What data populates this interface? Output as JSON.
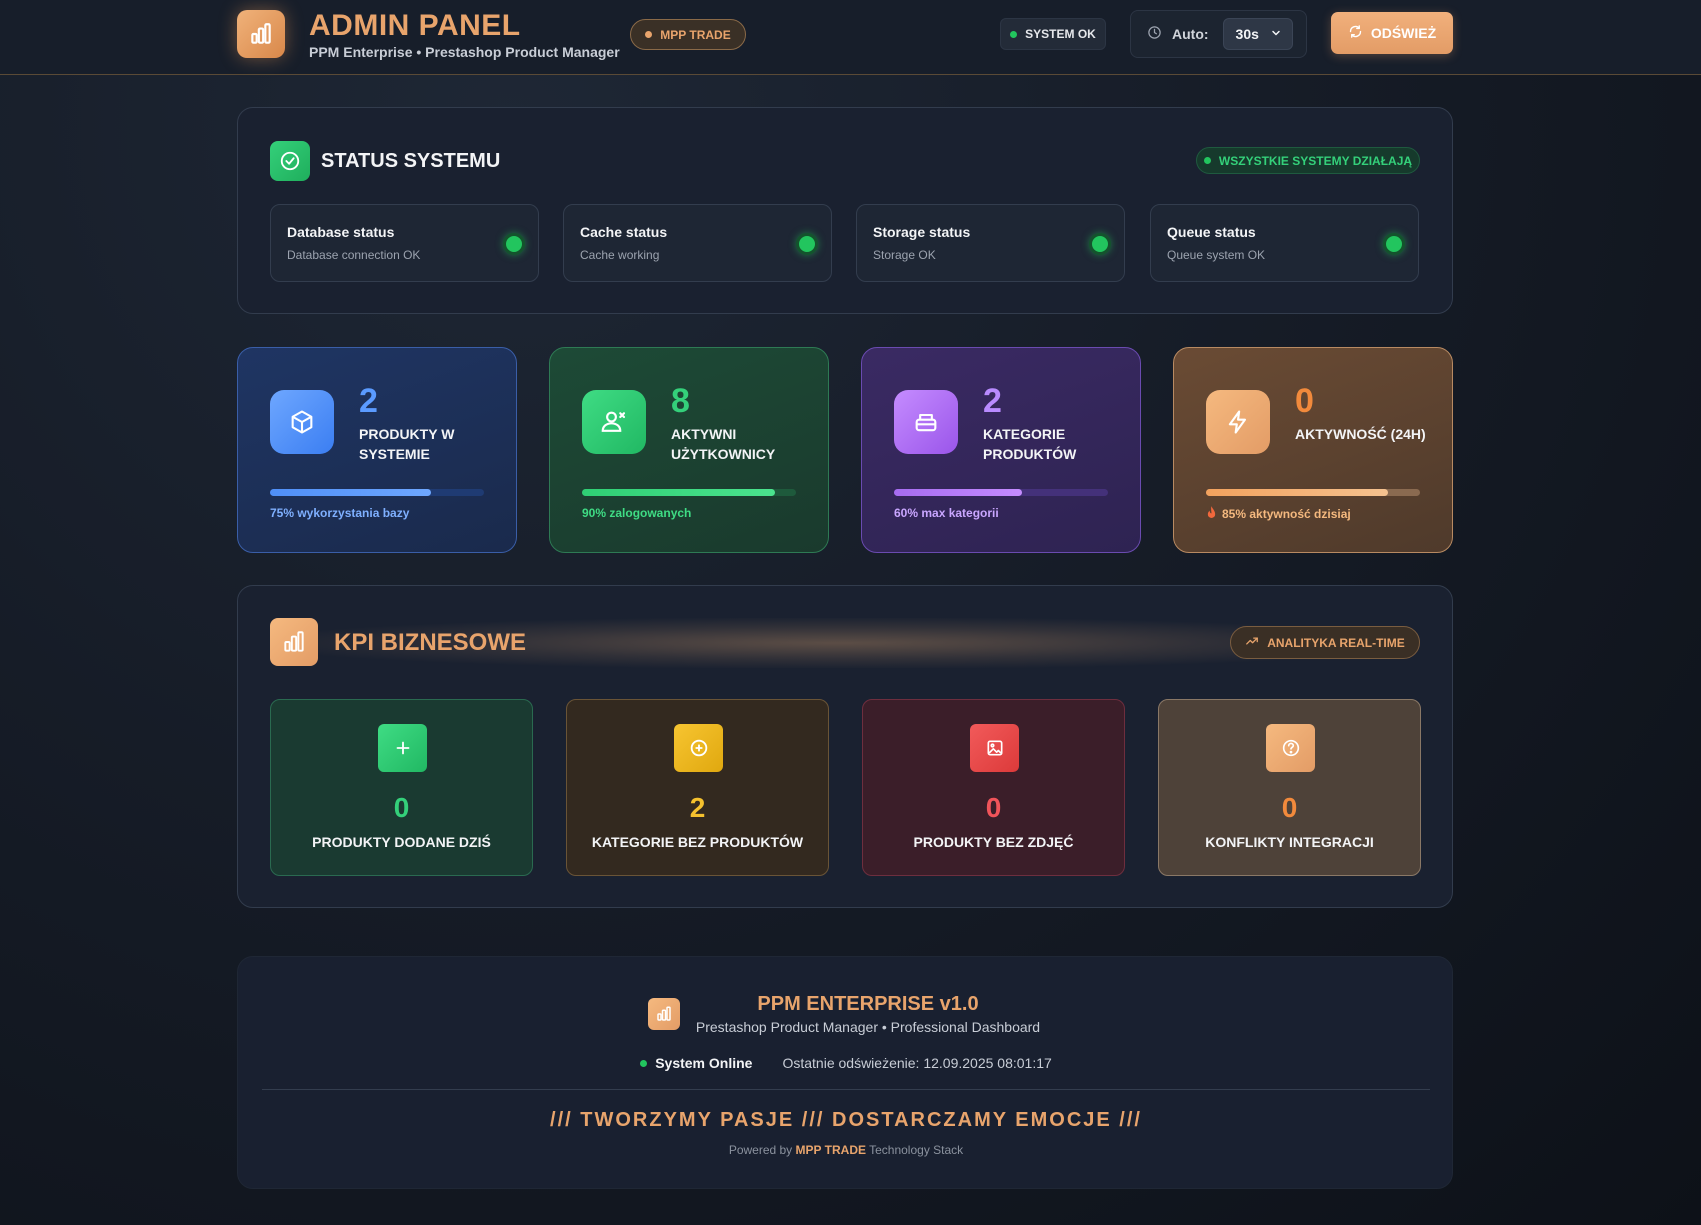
{
  "header": {
    "title": "ADMIN PANEL",
    "subtitle": "PPM Enterprise • Prestashop Product Manager",
    "brand_badge": "MPP TRADE",
    "system_status": "SYSTEM OK",
    "auto_label": "Auto:",
    "auto_value": "30s",
    "refresh_label": "ODŚWIEŻ"
  },
  "status_section": {
    "title": "STATUS SYSTEMU",
    "badge": "WSZYSTKIE SYSTEMY DZIAŁAJĄ",
    "items": [
      {
        "name": "Database status",
        "desc": "Database connection OK"
      },
      {
        "name": "Cache status",
        "desc": "Cache working"
      },
      {
        "name": "Storage status",
        "desc": "Storage OK"
      },
      {
        "name": "Queue status",
        "desc": "Queue system OK"
      }
    ]
  },
  "stats": [
    {
      "value": "2",
      "label": "PRODUKTY W SYSTEMIE",
      "note": "75% wykorzystania bazy",
      "progress": 0.75,
      "icon": "cube-icon"
    },
    {
      "value": "8",
      "label": "AKTYWNI UŻYTKOWNICY",
      "note": "90% zalogowanych",
      "progress": 0.9,
      "icon": "users-icon"
    },
    {
      "value": "2",
      "label": "KATEGORIE PRODUKTÓW",
      "note": "60% max kategorii",
      "progress": 0.6,
      "icon": "archive-icon"
    },
    {
      "value": "0",
      "label": "AKTYWNOŚĆ (24H)",
      "note": "85% aktywność dzisiaj",
      "progress": 0.85,
      "icon": "bolt-icon"
    }
  ],
  "kpi": {
    "title": "KPI BIZNESOWE",
    "badge": "ANALITYKA REAL-TIME",
    "items": [
      {
        "value": "0",
        "label": "PRODUKTY DODANE DZIŚ",
        "icon": "plus-icon"
      },
      {
        "value": "2",
        "label": "KATEGORIE BEZ PRODUKTÓW",
        "icon": "plus-circle-icon"
      },
      {
        "value": "0",
        "label": "PRODUKTY BEZ ZDJĘĆ",
        "icon": "image-icon"
      },
      {
        "value": "0",
        "label": "KONFLIKTY INTEGRACJI",
        "icon": "question-icon"
      }
    ]
  },
  "footer": {
    "title": "PPM ENTERPRISE v1.0",
    "subtitle": "Prestashop Product Manager • Professional Dashboard",
    "online": "System Online",
    "last_refresh": "Ostatnie odświeżenie: 12.09.2025 08:01:17",
    "slogan": "/// TWORZYMY PASJE /// DOSTARCZAMY EMOCJE ///",
    "powered_prefix": "Powered by",
    "powered_brand": "MPP TRADE",
    "powered_suffix": "Technology Stack"
  },
  "colors": {
    "accent": "#e8a46c",
    "ok": "#22c55e",
    "blue": "#4f8ff7",
    "green": "#2fcf74",
    "purple": "#b072f2",
    "orange": "#f2a25e"
  }
}
